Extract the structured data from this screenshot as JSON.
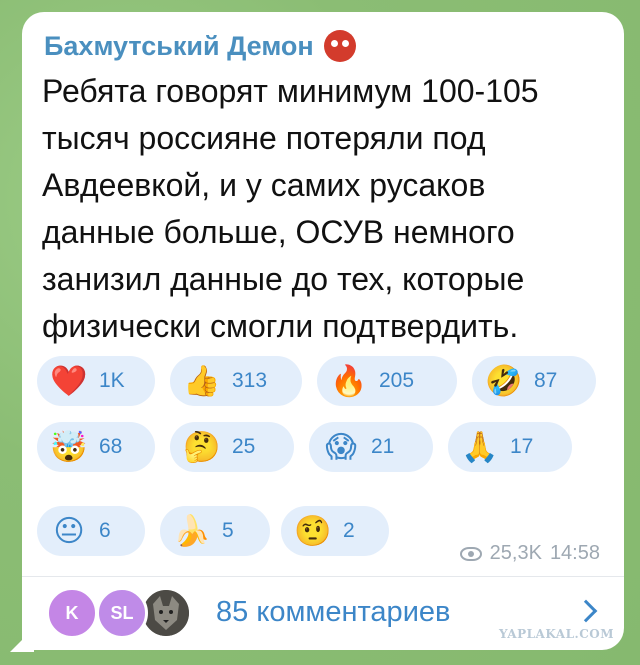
{
  "post": {
    "author": "Бахмутський Демон",
    "author_badge_icon": "devil-face-icon",
    "text_lines": [
      "Ребята говорят минимум 100-105",
      "тысяч россияне потеряли под",
      "Авдеевкой, и у самих русаков",
      "данные больше, ОСУВ немного",
      "занизил данные до тех, которые",
      "физически смогли подтвердить."
    ]
  },
  "reactions": [
    {
      "emoji": "❤️",
      "icon": "heart-icon",
      "count": "1K"
    },
    {
      "emoji": "👍",
      "icon": "thumbs-up-icon",
      "count": "313"
    },
    {
      "emoji": "🔥",
      "icon": "fire-icon",
      "count": "205"
    },
    {
      "emoji": "🤣",
      "icon": "rofl-icon",
      "count": "87"
    },
    {
      "emoji": "🤯",
      "icon": "exploding-head-icon",
      "count": "68"
    },
    {
      "emoji": "🤔",
      "icon": "thinking-face-icon",
      "count": "25"
    },
    {
      "emoji": "😱",
      "icon": "scream-face-icon",
      "count": "21"
    },
    {
      "emoji": "🙏",
      "icon": "pray-icon",
      "count": "17"
    },
    {
      "emoji": "😐",
      "icon": "neutral-face-icon",
      "count": "6"
    },
    {
      "emoji": "🍌",
      "icon": "banana-icon",
      "count": "5"
    },
    {
      "emoji": "🤨",
      "icon": "raised-eyebrow-icon",
      "count": "2"
    }
  ],
  "meta": {
    "views": "25,3K",
    "time": "14:58"
  },
  "comments": {
    "avatars": [
      "K",
      "SL",
      ""
    ],
    "label": "85 комментариев"
  },
  "watermark": "YAPLAKAL.COM",
  "colors": {
    "accent": "#3c86c8",
    "author": "#4a8fbf",
    "chip_bg": "#e3eefb",
    "background": "#8fc07a"
  }
}
